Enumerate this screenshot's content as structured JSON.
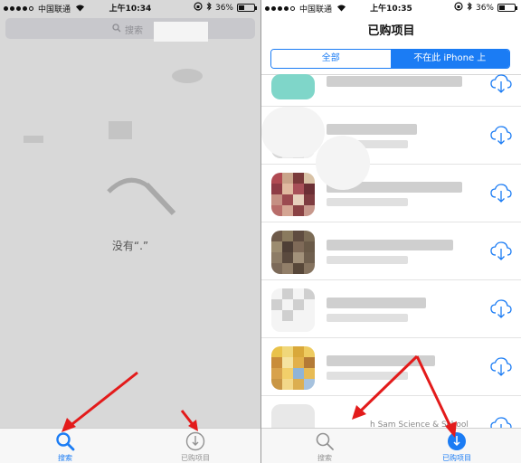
{
  "left_screen": {
    "status": {
      "carrier": "中国联通",
      "time": "上午10:34",
      "battery": "36%"
    },
    "search": {
      "placeholder": "搜索"
    },
    "empty_message": "没有“.”",
    "tabs": [
      {
        "label": "搜索",
        "icon": "search-icon",
        "active": true
      },
      {
        "label": "已购项目",
        "icon": "purchased-icon",
        "active": false
      }
    ]
  },
  "right_screen": {
    "status": {
      "carrier": "中国联通",
      "time": "上午10:35",
      "battery": "36%"
    },
    "title": "已购项目",
    "segments": [
      {
        "label": "全部",
        "selected": false
      },
      {
        "label": "不在此 iPhone 上",
        "selected": true
      }
    ],
    "rows": [
      {
        "name": ""
      },
      {
        "name": ""
      },
      {
        "name": ""
      },
      {
        "name": ""
      },
      {
        "name": ""
      },
      {
        "name": ""
      },
      {
        "name": "h Sam Science & School"
      }
    ],
    "tabs": [
      {
        "label": "搜索",
        "icon": "search-icon",
        "active": false
      },
      {
        "label": "已购项目",
        "icon": "purchased-icon",
        "active": true
      }
    ]
  },
  "colors": {
    "accent": "#1b7cf4",
    "arrow": "#e31b1b"
  }
}
